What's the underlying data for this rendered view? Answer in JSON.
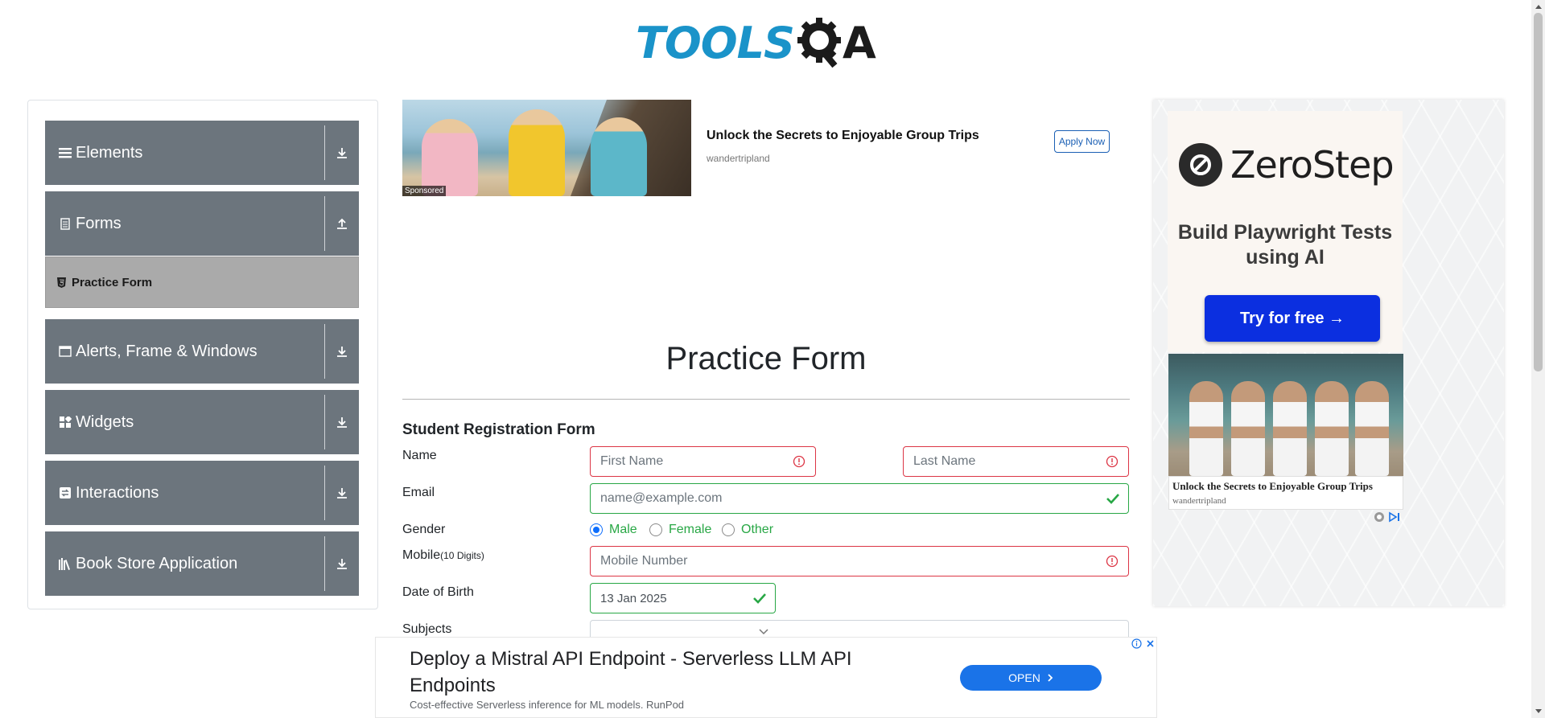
{
  "logo": {
    "text": "TOOLS",
    "suffix": "A",
    "brand_color": "#1a93c9"
  },
  "sidebar": {
    "groups": [
      {
        "label": "Elements",
        "icon": "menu-icon",
        "arrow": "download-icon"
      },
      {
        "label": "Forms",
        "icon": "document-icon",
        "arrow": "upload-icon"
      },
      {
        "label": "Alerts, Frame & Windows",
        "icon": "window-icon",
        "arrow": "download-icon"
      },
      {
        "label": "Widgets",
        "icon": "widgets-icon",
        "arrow": "download-icon"
      },
      {
        "label": "Interactions",
        "icon": "interactions-icon",
        "arrow": "download-icon"
      },
      {
        "label": "Book Store Application",
        "icon": "books-icon",
        "arrow": "download-icon"
      }
    ],
    "active_subitem": {
      "label": "Practice Form",
      "icon": "html5-icon"
    },
    "group_color": "#6c757d"
  },
  "ad_top": {
    "title": "Unlock the Secrets to Enjoyable Group Trips",
    "domain": "wandertripland",
    "sponsored": "Sponsored",
    "cta": "Apply Now"
  },
  "main": {
    "title": "Practice Form",
    "form_heading": "Student Registration Form",
    "labels": {
      "name": "Name",
      "email": "Email",
      "gender": "Gender",
      "mobile": "Mobile",
      "mobile_hint": "(10 Digits)",
      "dob": "Date of Birth",
      "subjects": "Subjects"
    },
    "fields": {
      "first_name_placeholder": "First Name",
      "last_name_placeholder": "Last Name",
      "email_placeholder": "name@example.com",
      "mobile_placeholder": "Mobile Number",
      "dob_value": "13 Jan 2025"
    },
    "gender_options": [
      {
        "label": "Male",
        "selected": true
      },
      {
        "label": "Female",
        "selected": false
      },
      {
        "label": "Other",
        "selected": false
      }
    ],
    "colors": {
      "invalid": "#dc3545",
      "valid": "#28a745"
    }
  },
  "ad_right": {
    "brand": "ZeroStep",
    "tagline": "Build Playwright Tests using AI",
    "cta": "Try for free →",
    "caption_title": "Unlock the Secrets to Enjoyable Group Trips",
    "caption_domain": "wandertripland"
  },
  "ad_bottom": {
    "title": "Deploy a Mistral API Endpoint - Serverless LLM API Endpoints",
    "subtitle": "Cost-effective Serverless inference for ML models. RunPod",
    "cta": "OPEN"
  }
}
